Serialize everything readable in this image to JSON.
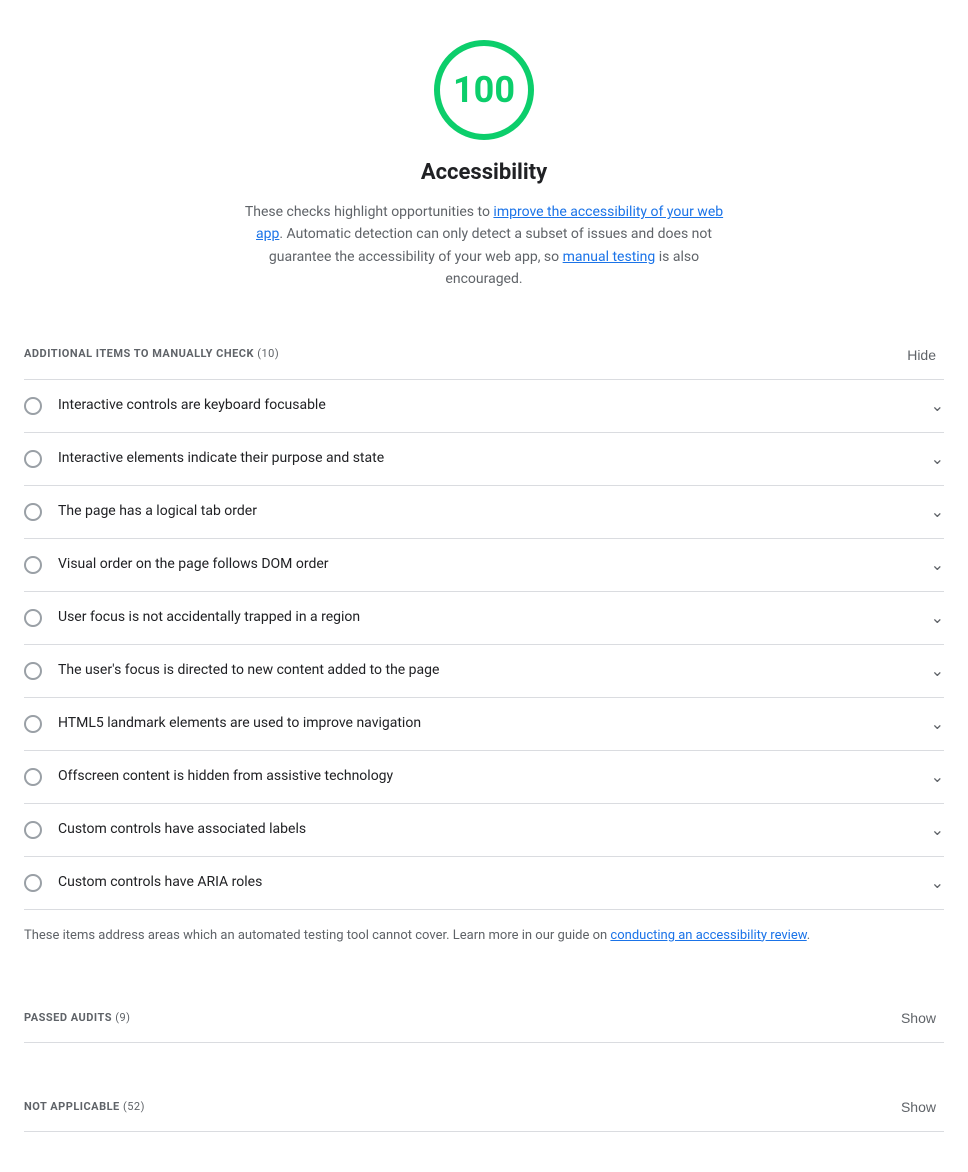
{
  "score": {
    "value": "100",
    "label": "Accessibility",
    "description_text": "These checks highlight opportunities to ",
    "link1_text": "improve the accessibility of your web app",
    "link1_href": "#",
    "description_middle": ". Automatic detection can only detect a subset of issues and does not guarantee the accessibility of your web app, so ",
    "link2_text": "manual testing",
    "link2_href": "#",
    "description_end": " is also encouraged."
  },
  "manual_section": {
    "title": "ADDITIONAL ITEMS TO MANUALLY CHECK",
    "count": "(10)",
    "toggle_label": "Hide"
  },
  "audit_items": [
    {
      "label": "Interactive controls are keyboard focusable"
    },
    {
      "label": "Interactive elements indicate their purpose and state"
    },
    {
      "label": "The page has a logical tab order"
    },
    {
      "label": "Visual order on the page follows DOM order"
    },
    {
      "label": "User focus is not accidentally trapped in a region"
    },
    {
      "label": "The user's focus is directed to new content added to the page"
    },
    {
      "label": "HTML5 landmark elements are used to improve navigation"
    },
    {
      "label": "Offscreen content is hidden from assistive technology"
    },
    {
      "label": "Custom controls have associated labels"
    },
    {
      "label": "Custom controls have ARIA roles"
    }
  ],
  "manual_note": {
    "prefix": "These items address areas which an automated testing tool cannot cover. Learn more in our guide on ",
    "link_text": "conducting an accessibility review",
    "link_href": "#",
    "suffix": "."
  },
  "passed_section": {
    "title": "PASSED AUDITS",
    "count": "(9)",
    "toggle_label": "Show"
  },
  "not_applicable_section": {
    "title": "NOT APPLICABLE",
    "count": "(52)",
    "toggle_label": "Show"
  }
}
